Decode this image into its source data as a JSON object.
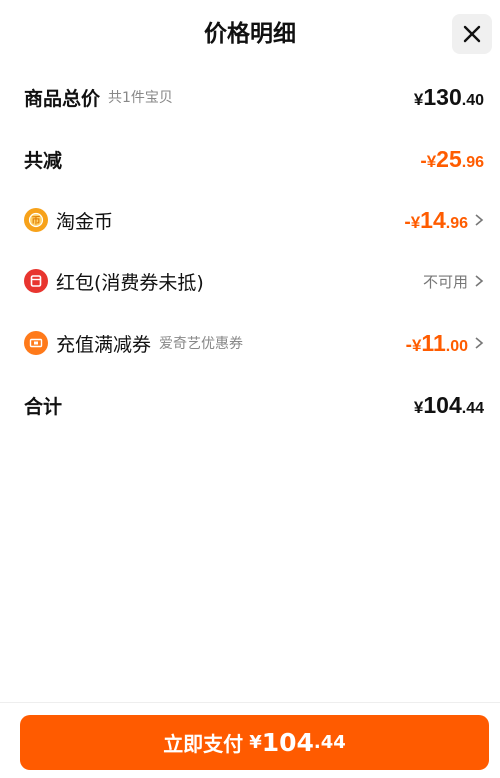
{
  "header": {
    "title": "价格明细",
    "close_icon": "close-icon"
  },
  "items_total": {
    "label": "商品总价",
    "sublabel": "共1件宝贝",
    "currency": "¥",
    "int": "130",
    "dec": ".40"
  },
  "total_discount": {
    "label": "共减",
    "minus": "-",
    "currency": "¥",
    "int": "25",
    "dec": ".96"
  },
  "discounts": [
    {
      "icon": "gold-coin-icon",
      "label": "淘金币",
      "sublabel": "",
      "minus": "-",
      "currency": "¥",
      "int": "14",
      "dec": ".96",
      "available": true
    },
    {
      "icon": "red-packet-icon",
      "label": "红包(消费券未抵)",
      "sublabel": "",
      "status": "不可用",
      "available": false
    },
    {
      "icon": "coupon-icon",
      "label": "充值满减券",
      "sublabel": "爱奇艺优惠券",
      "minus": "-",
      "currency": "¥",
      "int": "11",
      "dec": ".00",
      "available": true
    }
  ],
  "grand_total": {
    "label": "合计",
    "currency": "¥",
    "int": "104",
    "dec": ".44"
  },
  "pay_button": {
    "label": "立即支付",
    "currency": "¥",
    "int": "104",
    "dec": ".44"
  },
  "colors": {
    "accent": "#ff5c00",
    "button": "#ff5b00",
    "coin": "#f7a21a",
    "red_packet": "#e8352f",
    "coupon": "#ff7a1a"
  }
}
